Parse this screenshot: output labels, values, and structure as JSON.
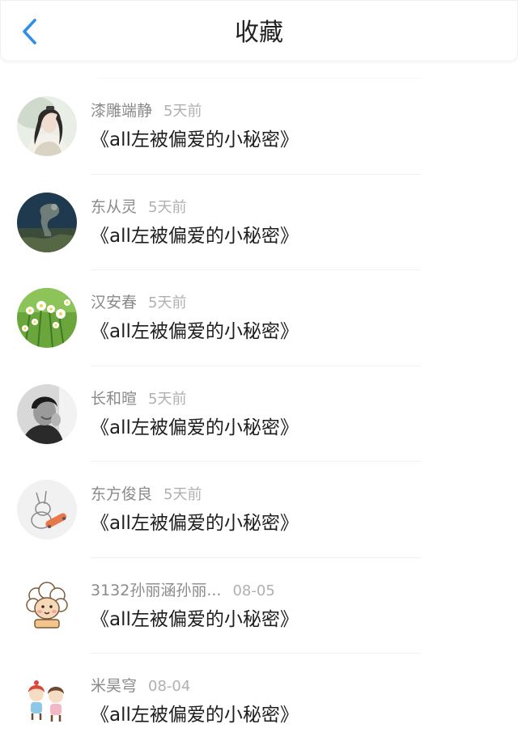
{
  "header": {
    "title": "收藏"
  },
  "items": [
    {
      "author": "漆雕端静",
      "time": "5天前",
      "title": "《all左被偏爱的小秘密》",
      "avatar": "ancient-costume-portrait"
    },
    {
      "author": "东从灵",
      "time": "5天前",
      "title": "《all左被偏爱的小秘密》",
      "avatar": "dark-night-scene"
    },
    {
      "author": "汉安春",
      "time": "5天前",
      "title": "《all左被偏爱的小秘密》",
      "avatar": "white-flowers"
    },
    {
      "author": "长和暄",
      "time": "5天前",
      "title": "《all左被偏爱的小秘密》",
      "avatar": "monochrome-man-portrait"
    },
    {
      "author": "东方俊良",
      "time": "5天前",
      "title": "《all左被偏爱的小秘密》",
      "avatar": "rabbit-sketch"
    },
    {
      "author": "3132孙丽涵孙丽...",
      "time": "08-05",
      "title": "《all左被偏爱的小秘密》",
      "avatar": "cartoon-sheep"
    },
    {
      "author": "米昊穹",
      "time": "08-04",
      "title": "《all左被偏爱的小秘密》",
      "avatar": "cartoon-couple"
    }
  ],
  "colors": {
    "accent": "#2f8fe8",
    "title_text": "#1e1e1e",
    "meta_text": "#8a8a8a"
  }
}
